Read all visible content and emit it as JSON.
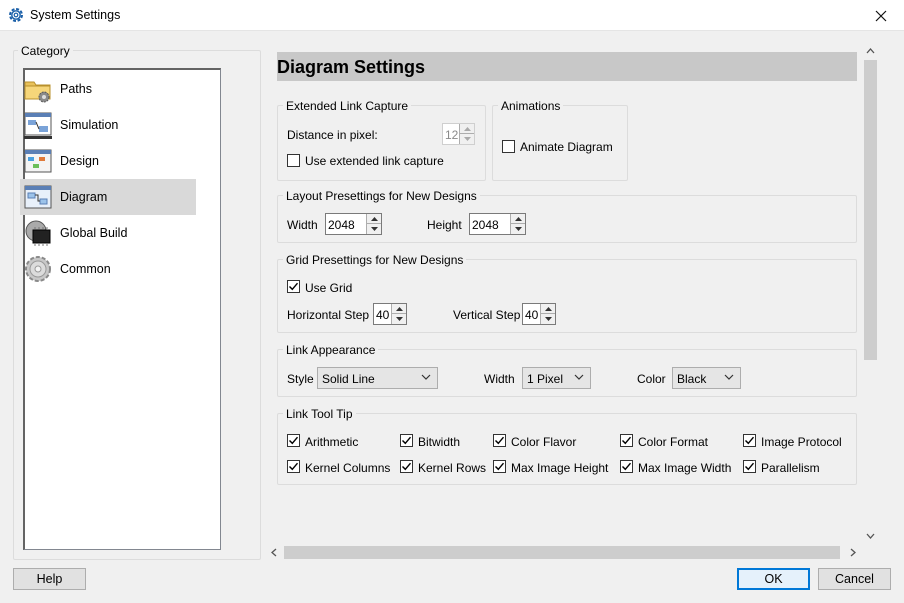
{
  "window": {
    "title": "System Settings",
    "icon": "gear-icon"
  },
  "category": {
    "legend": "Category",
    "items": [
      {
        "label": "Paths",
        "icon": "folder-gear-icon",
        "selected": false
      },
      {
        "label": "Simulation",
        "icon": "simulation-icon",
        "selected": false
      },
      {
        "label": "Design",
        "icon": "design-icon",
        "selected": false
      },
      {
        "label": "Diagram",
        "icon": "diagram-icon",
        "selected": true
      },
      {
        "label": "Global Build",
        "icon": "chip-icon",
        "selected": false
      },
      {
        "label": "Common",
        "icon": "common-gear-icon",
        "selected": false
      }
    ]
  },
  "header": {
    "title": "Diagram Settings"
  },
  "extended_link": {
    "title": "Extended Link Capture",
    "distance_label": "Distance in pixel:",
    "distance_value": "12",
    "use_extended_label": "Use extended link capture",
    "use_extended_checked": false
  },
  "animations": {
    "title": "Animations",
    "animate_label": "Animate Diagram",
    "animate_checked": false
  },
  "layout": {
    "title": "Layout Presettings for New Designs",
    "width_label": "Width",
    "width_value": "2048",
    "height_label": "Height",
    "height_value": "2048"
  },
  "grid": {
    "title": "Grid Presettings for New Designs",
    "use_grid_label": "Use Grid",
    "use_grid_checked": true,
    "hstep_label": "Horizontal Step",
    "hstep_value": "40",
    "vstep_label": "Vertical Step",
    "vstep_value": "40"
  },
  "appearance": {
    "title": "Link Appearance",
    "style_label": "Style",
    "style_value": "Solid Line",
    "width_label": "Width",
    "width_value": "1 Pixel",
    "color_label": "Color",
    "color_value": "Black"
  },
  "tooltip": {
    "title": "Link Tool Tip",
    "items": [
      {
        "label": "Arithmetic",
        "checked": true
      },
      {
        "label": "Bitwidth",
        "checked": true
      },
      {
        "label": "Color Flavor",
        "checked": true
      },
      {
        "label": "Color Format",
        "checked": true
      },
      {
        "label": "Image Protocol",
        "checked": true
      },
      {
        "label": "Kernel Columns",
        "checked": true
      },
      {
        "label": "Kernel Rows",
        "checked": true
      },
      {
        "label": "Max Image Height",
        "checked": true
      },
      {
        "label": "Max Image Width",
        "checked": true
      },
      {
        "label": "Parallelism",
        "checked": true
      }
    ]
  },
  "buttons": {
    "help": "Help",
    "ok": "OK",
    "cancel": "Cancel"
  },
  "colors": {
    "accent": "#0078d7",
    "selected_bg": "#d9d9d9",
    "header_bg": "#c8c8c8"
  }
}
